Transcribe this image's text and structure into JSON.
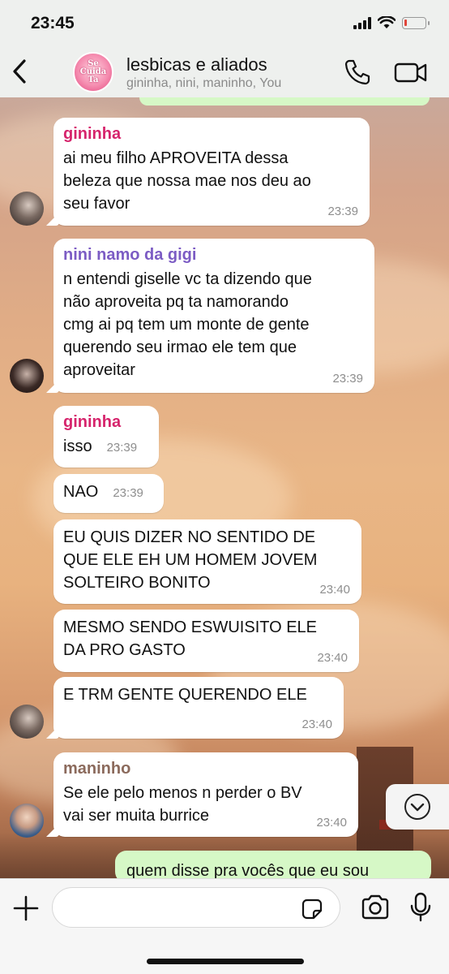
{
  "status_bar": {
    "time": "23:45",
    "battery_level": 0.15
  },
  "header": {
    "title": "lesbicas e aliados",
    "subtitle": "gininha, nini, maninho, You",
    "avatar_text": "Se Cuida Ta"
  },
  "messages": [
    {
      "sender": "gininha",
      "sender_color": "#d6246c",
      "text": "ai meu filho APROVEITA dessa\nbeleza que nossa mae nos deu ao\nseu favor",
      "time": "23:39"
    },
    {
      "sender": "nini namo da gigi",
      "sender_color": "#7c5cc4",
      "text": "n entendi giselle vc ta dizendo que\nnão aproveita pq ta namorando\ncmg ai pq tem um monte de gente\nquerendo seu irmao ele tem que\naproveitar",
      "time": "23:39"
    },
    {
      "sender": "gininha",
      "sender_color": "#d6246c",
      "text": "isso",
      "time": "23:39"
    },
    {
      "text": "NAO",
      "time": "23:39"
    },
    {
      "text": "EU QUIS DIZER NO SENTIDO DE\nQUE ELE EH UM HOMEM JOVEM\nSOLTEIRO BONITO",
      "time": "23:40"
    },
    {
      "text": "MESMO SENDO ESWUISITO ELE\nDA PRO GASTO",
      "time": "23:40"
    },
    {
      "text": "E TRM GENTE QUERENDO ELE",
      "time": "23:40"
    },
    {
      "sender": "maninho",
      "sender_color": "#8b6a5c",
      "text": "Se ele pelo menos n perder o BV\nvai ser muita burrice",
      "time": "23:40"
    }
  ],
  "outgoing_partial": "quem disse pra vocês que eu sou",
  "input": {
    "placeholder": ""
  },
  "icons": {
    "back": "chevron-left-icon",
    "call": "phone-icon",
    "video": "video-camera-icon",
    "scroll": "chevron-down-circle-icon",
    "plus": "plus-icon",
    "sticker": "sticker-icon",
    "camera": "camera-icon",
    "mic": "microphone-icon"
  },
  "colors": {
    "outgoing_bubble": "#d6f8c6",
    "incoming_bubble": "#ffffff",
    "header_bg": "#eef0ee"
  }
}
